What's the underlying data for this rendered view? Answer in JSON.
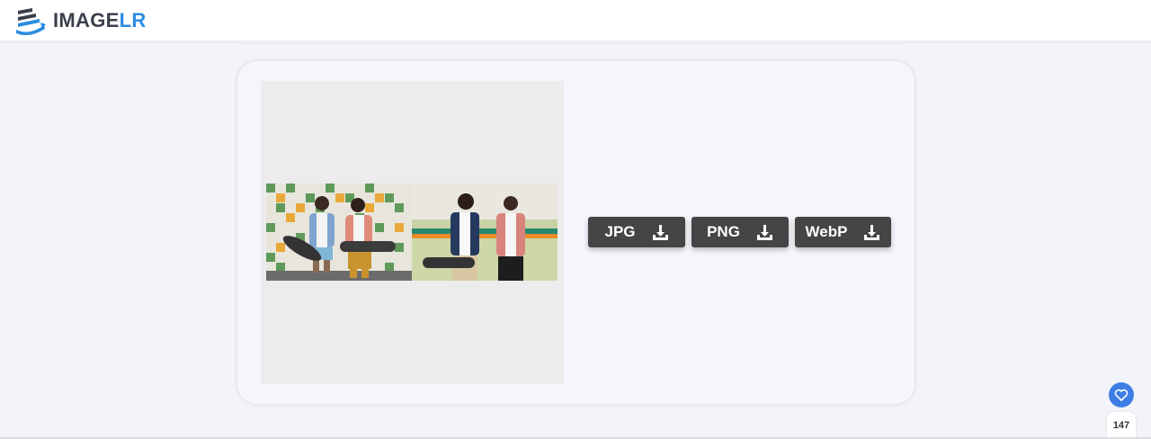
{
  "header": {
    "logo_part1": "IMAGE",
    "logo_part2": "LR",
    "logo_icon": "imagelr-logo-icon"
  },
  "preview": {
    "image_icon": "preview-image"
  },
  "downloads": [
    {
      "label": "JPG",
      "icon": "download-icon"
    },
    {
      "label": "PNG",
      "icon": "download-icon"
    },
    {
      "label": "WebP",
      "icon": "download-icon"
    }
  ],
  "like_widget": {
    "icon": "heart-icon",
    "count": "147"
  },
  "colors": {
    "page_bg": "#f3f4f9",
    "button_bg": "#454545",
    "accent": "#2b8ce0",
    "like_bg": "#3d7ee6"
  }
}
